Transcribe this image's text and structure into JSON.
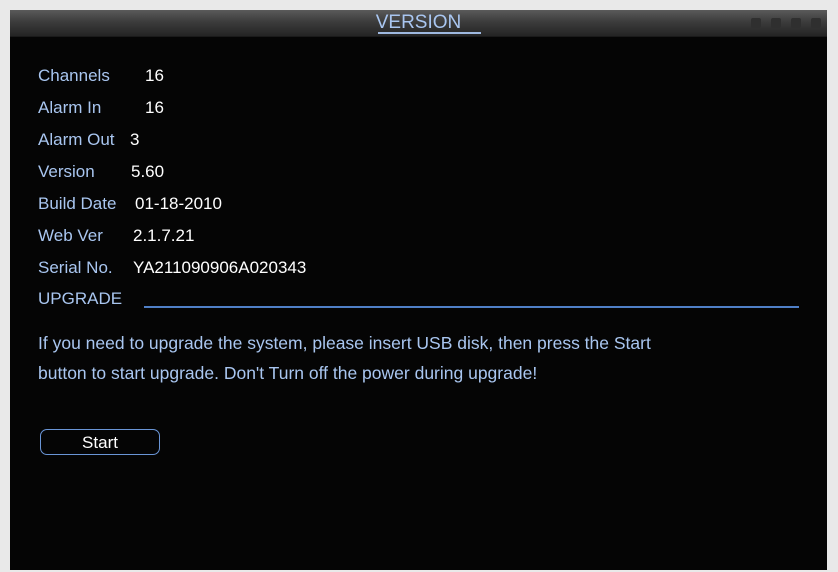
{
  "window": {
    "title": "VERSION"
  },
  "info": {
    "channels": {
      "label": "Channels",
      "value": "16"
    },
    "alarm_in": {
      "label": "Alarm In",
      "value": "16"
    },
    "alarm_out": {
      "label": "Alarm Out",
      "value": "3"
    },
    "version": {
      "label": "Version",
      "value": "5.60"
    },
    "build_date": {
      "label": "Build Date",
      "value": "01-18-2010"
    },
    "web_ver": {
      "label": "Web Ver",
      "value": "2.1.7.21"
    },
    "serial_no": {
      "label": "Serial No.",
      "value": "YA211090906A020343"
    }
  },
  "upgrade": {
    "section_title": "UPGRADE",
    "message_line1": "If you need to upgrade the system, please insert USB disk, then press the Start",
    "message_line2": "button to start upgrade. Don't Turn off the power during upgrade!",
    "start_label": "Start"
  },
  "colors": {
    "label_text": "#a9c6f0",
    "value_text": "#ffffff",
    "background": "#050505",
    "accent_line": "#4f7fc6"
  }
}
